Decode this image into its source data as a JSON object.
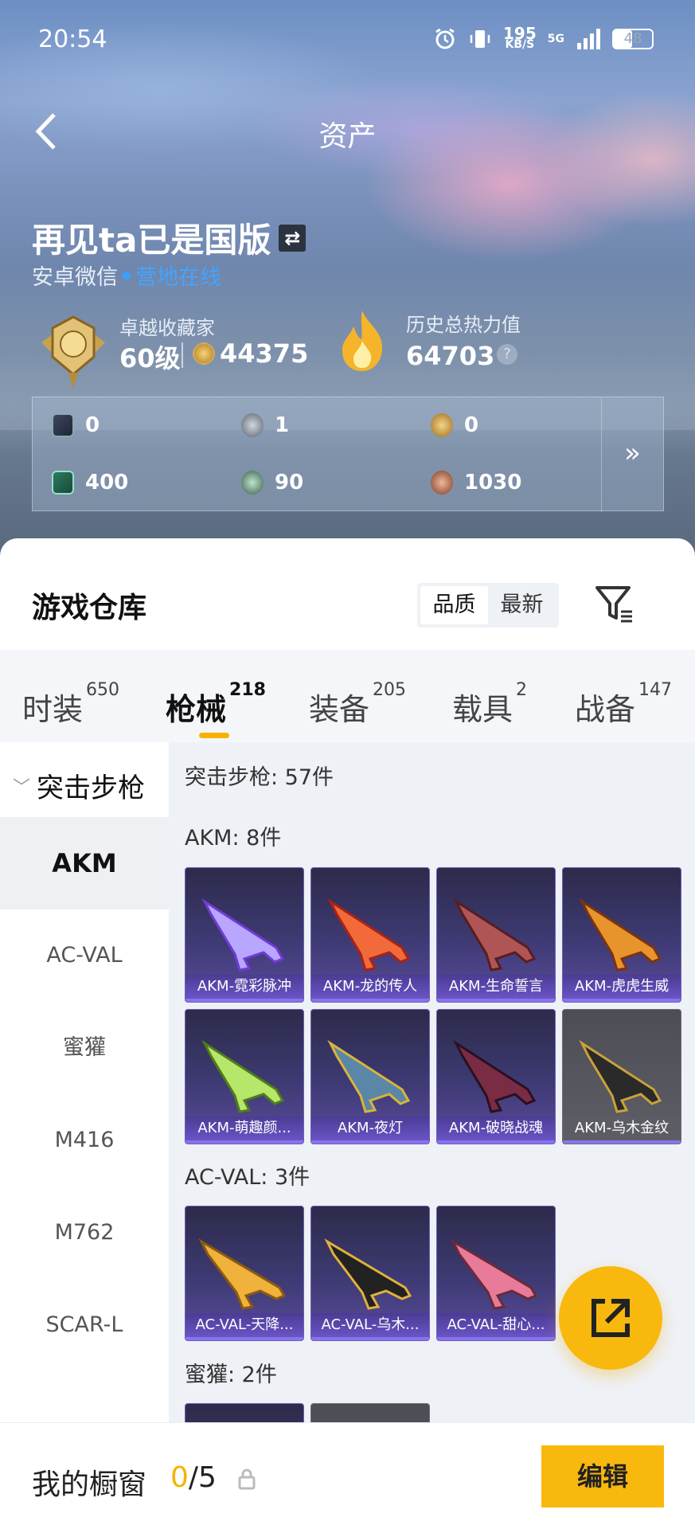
{
  "status_bar": {
    "time": "20:54",
    "net_speed": "195",
    "net_unit": "KB/S",
    "signal": "5G",
    "battery": "48"
  },
  "header": {
    "title": "资产"
  },
  "profile": {
    "username": "再见ta已是国版",
    "platform": "安卓微信",
    "online_status": "营地在线",
    "collector_title": "卓越收藏家",
    "collector_level": "60级",
    "coins": "44375",
    "history_label": "历史总热力值",
    "history_value": "64703",
    "help": "?"
  },
  "resources": [
    {
      "icon": "card-icon",
      "value": "0"
    },
    {
      "icon": "silver-coin-icon",
      "value": "1"
    },
    {
      "icon": "gold-badge-icon",
      "value": "0"
    },
    {
      "icon": "green-card-icon",
      "value": "400"
    },
    {
      "icon": "gem-icon",
      "value": "90"
    },
    {
      "icon": "bronze-coin-icon",
      "value": "1030"
    }
  ],
  "resources_more": "»",
  "warehouse": {
    "title": "游戏仓库",
    "sort_options": [
      "品质",
      "最新"
    ],
    "sort_selected": "品质"
  },
  "tabs": [
    {
      "label": "时装",
      "count": "650"
    },
    {
      "label": "枪械",
      "count": "218"
    },
    {
      "label": "装备",
      "count": "205"
    },
    {
      "label": "载具",
      "count": "2"
    },
    {
      "label": "战备",
      "count": "147"
    }
  ],
  "sidebar": {
    "category": "突击步枪",
    "items": [
      "AKM",
      "AC-VAL",
      "蜜獾",
      "M416",
      "M762",
      "SCAR-L"
    ],
    "selected": "AKM"
  },
  "content": {
    "category_summary": "突击步枪: 57件",
    "groups": [
      {
        "title": "AKM: 8件",
        "items": [
          "AKM-霓彩脉冲",
          "AKM-龙的传人",
          "AKM-生命誓言",
          "AKM-虎虎生威",
          "AKM-萌趣颜...",
          "AKM-夜灯",
          "AKM-破晓战魂",
          "AKM-乌木金纹"
        ]
      },
      {
        "title": "AC-VAL: 3件",
        "items": [
          "AC-VAL-天降...",
          "AC-VAL-乌木...",
          "AC-VAL-甜心..."
        ]
      },
      {
        "title": "蜜獾: 2件",
        "items": [
          "",
          ""
        ]
      }
    ]
  },
  "colors": {
    "accent": "#f9b80e",
    "card_purple": "#3e3a74",
    "online_blue": "#43a4ff"
  },
  "bottom_bar": {
    "label": "我的橱窗",
    "count_current": "0",
    "count_total": "/5",
    "edit": "编辑"
  }
}
